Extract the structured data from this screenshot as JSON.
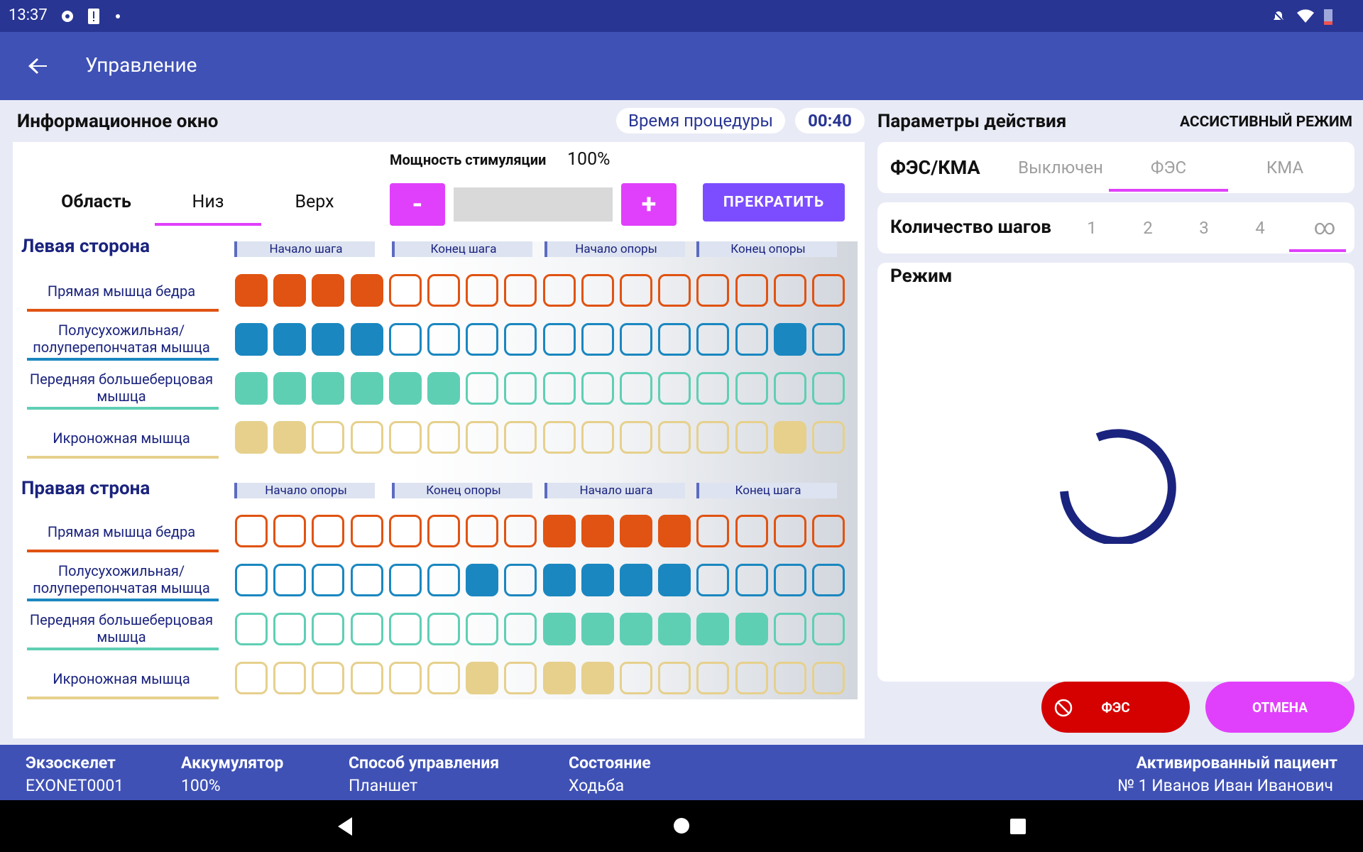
{
  "status": {
    "time": "13:37"
  },
  "app_bar": {
    "title": "Управление"
  },
  "info": {
    "title": "Информационное окно",
    "proc_time_label": "Время процедуры",
    "proc_time_value": "00:40"
  },
  "stim": {
    "label": "Мощность стимуляции",
    "value": "100%",
    "minus": "-",
    "plus": "+",
    "stop": "ПРЕКРАТИТЬ"
  },
  "tabs": {
    "area": "Область",
    "low": "Низ",
    "up": "Верх"
  },
  "left_side": {
    "title": "Левая сторона",
    "phases": [
      "Начало шага",
      "Конец шага",
      "Начало опоры",
      "Конец опоры"
    ]
  },
  "right_side": {
    "title": "Правая строна",
    "phases": [
      "Начало опоры",
      "Конец опоры",
      "Начало шага",
      "Конец шага"
    ]
  },
  "muscles": [
    "Прямая мышца бедра",
    "Полусухожильная/ полуперепончатая мышца",
    "Передняя большеберцовая мышца",
    "Икроножная мышца"
  ],
  "muscle_colors": [
    "#e05312",
    "#1a87c0",
    "#5fcfb4",
    "#e6d08c"
  ],
  "grid_left": [
    [
      1,
      1,
      1,
      1,
      0,
      0,
      0,
      0,
      0,
      0,
      0,
      0,
      0,
      0,
      0,
      0
    ],
    [
      1,
      1,
      1,
      1,
      0,
      0,
      0,
      0,
      0,
      0,
      0,
      0,
      0,
      0,
      1,
      0
    ],
    [
      1,
      1,
      1,
      1,
      1,
      1,
      0,
      0,
      0,
      0,
      0,
      0,
      0,
      0,
      0,
      0
    ],
    [
      1,
      1,
      0,
      0,
      0,
      0,
      0,
      0,
      0,
      0,
      0,
      0,
      0,
      0,
      1,
      0
    ]
  ],
  "grid_right": [
    [
      0,
      0,
      0,
      0,
      0,
      0,
      0,
      0,
      1,
      1,
      1,
      1,
      0,
      0,
      0,
      0
    ],
    [
      0,
      0,
      0,
      0,
      0,
      0,
      1,
      0,
      1,
      1,
      1,
      1,
      0,
      0,
      0,
      0
    ],
    [
      0,
      0,
      0,
      0,
      0,
      0,
      0,
      0,
      1,
      1,
      1,
      1,
      1,
      1,
      0,
      0
    ],
    [
      0,
      0,
      0,
      0,
      0,
      0,
      1,
      0,
      1,
      1,
      0,
      0,
      0,
      0,
      0,
      0
    ]
  ],
  "params": {
    "title": "Параметры действия",
    "mode_label": "АССИСТИВНЫЙ РЕЖИМ"
  },
  "fes": {
    "label": "ФЭС/КМА",
    "options": [
      "Выключен",
      "ФЭС",
      "КМА"
    ],
    "selected": "ФЭС"
  },
  "steps": {
    "label": "Количество шагов",
    "options": [
      "1",
      "2",
      "3",
      "4",
      "∞"
    ],
    "selected": "∞"
  },
  "mode": {
    "label": "Режим"
  },
  "buttons": {
    "fes": "ФЭС",
    "cancel": "ОТМЕНА"
  },
  "bottom": {
    "exo_label": "Экзоскелет",
    "exo_val": "EXONET0001",
    "bat_label": "Аккумулятор",
    "bat_val": "100%",
    "ctrl_label": "Способ управления",
    "ctrl_val": "Планшет",
    "state_label": "Состояние",
    "state_val": "Ходьба",
    "patient_label": "Активированный пациент",
    "patient_val": "№ 1 Иванов Иван Иванович"
  }
}
